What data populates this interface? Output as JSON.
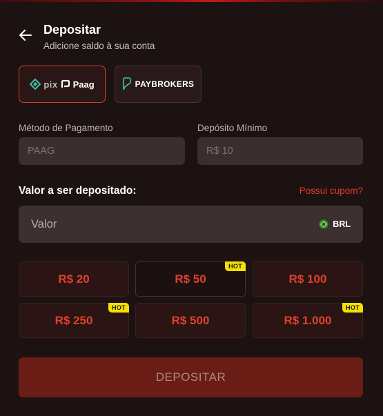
{
  "header": {
    "title": "Depositar",
    "subtitle": "Adicione saldo à sua conta",
    "back_icon": "arrow-left-icon"
  },
  "providers": [
    {
      "id": "pix-paag",
      "logo_text_1": "pix",
      "logo_text_2": "Paag",
      "selected": true
    },
    {
      "id": "paybrokers",
      "logo_text": "PAYBROKERS",
      "selected": false
    }
  ],
  "fields": {
    "method_label": "Método de Pagamento",
    "method_value": "PAAG",
    "min_label": "Depósito Mínimo",
    "min_value": "R$ 10"
  },
  "amount": {
    "label": "Valor a ser depositado:",
    "coupon_link": "Possui cupom?",
    "input_placeholder": "Valor",
    "currency": "BRL"
  },
  "quick_amounts": [
    {
      "label": "R$ 20",
      "hot": false
    },
    {
      "label": "R$ 50",
      "hot": true
    },
    {
      "label": "R$ 100",
      "hot": false
    },
    {
      "label": "R$ 250",
      "hot": true
    },
    {
      "label": "R$ 500",
      "hot": false
    },
    {
      "label": "R$ 1.000",
      "hot": true
    }
  ],
  "hot_badge": "HOT",
  "deposit_button": "DEPOSITAR",
  "colors": {
    "accent": "#e0412c",
    "background": "#1c1212",
    "hot_badge": "#f5e100",
    "deposit_button": "#6a1d14"
  }
}
